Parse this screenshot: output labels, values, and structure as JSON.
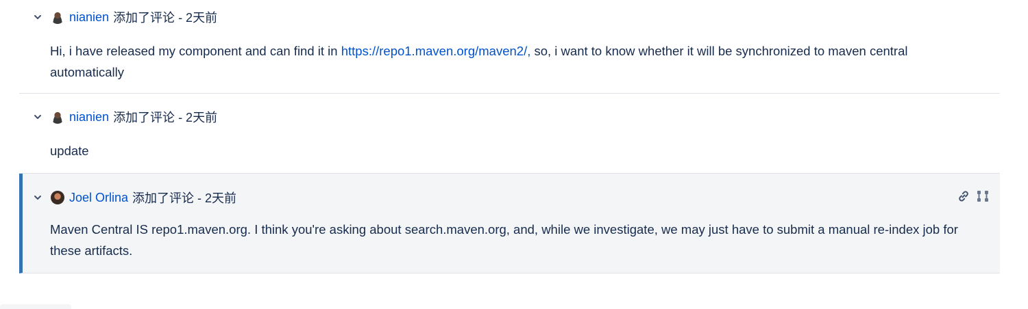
{
  "comments": [
    {
      "author": "nianien",
      "action": "添加了评论 - 2天前",
      "body_before": "Hi, i have released my component and can find it in ",
      "link": "https://repo1.maven.org/maven2/,",
      "body_after": "  so, i want to know whether it will be synchronized to maven central automatically",
      "avatar_icon": "user-avatar-icon"
    },
    {
      "author": "nianien",
      "action": "添加了评论 - 2天前",
      "body": "update",
      "avatar_icon": "user-avatar-icon"
    },
    {
      "author": "Joel Orlina",
      "action": "添加了评论 - 2天前",
      "body": "Maven Central IS repo1.maven.org. I think you're asking about search.maven.org, and, while we investigate, we may just have to submit a manual re-index job for these artifacts.",
      "avatar_icon": "user-avatar-icon",
      "tools": [
        "permalink-icon",
        "branch-icon"
      ]
    }
  ],
  "colors": {
    "link": "#0052cc",
    "text": "#172b4d",
    "highlight_bg": "#f4f5f7",
    "highlight_border": "#3572b0",
    "divider": "#dfe1e6"
  }
}
